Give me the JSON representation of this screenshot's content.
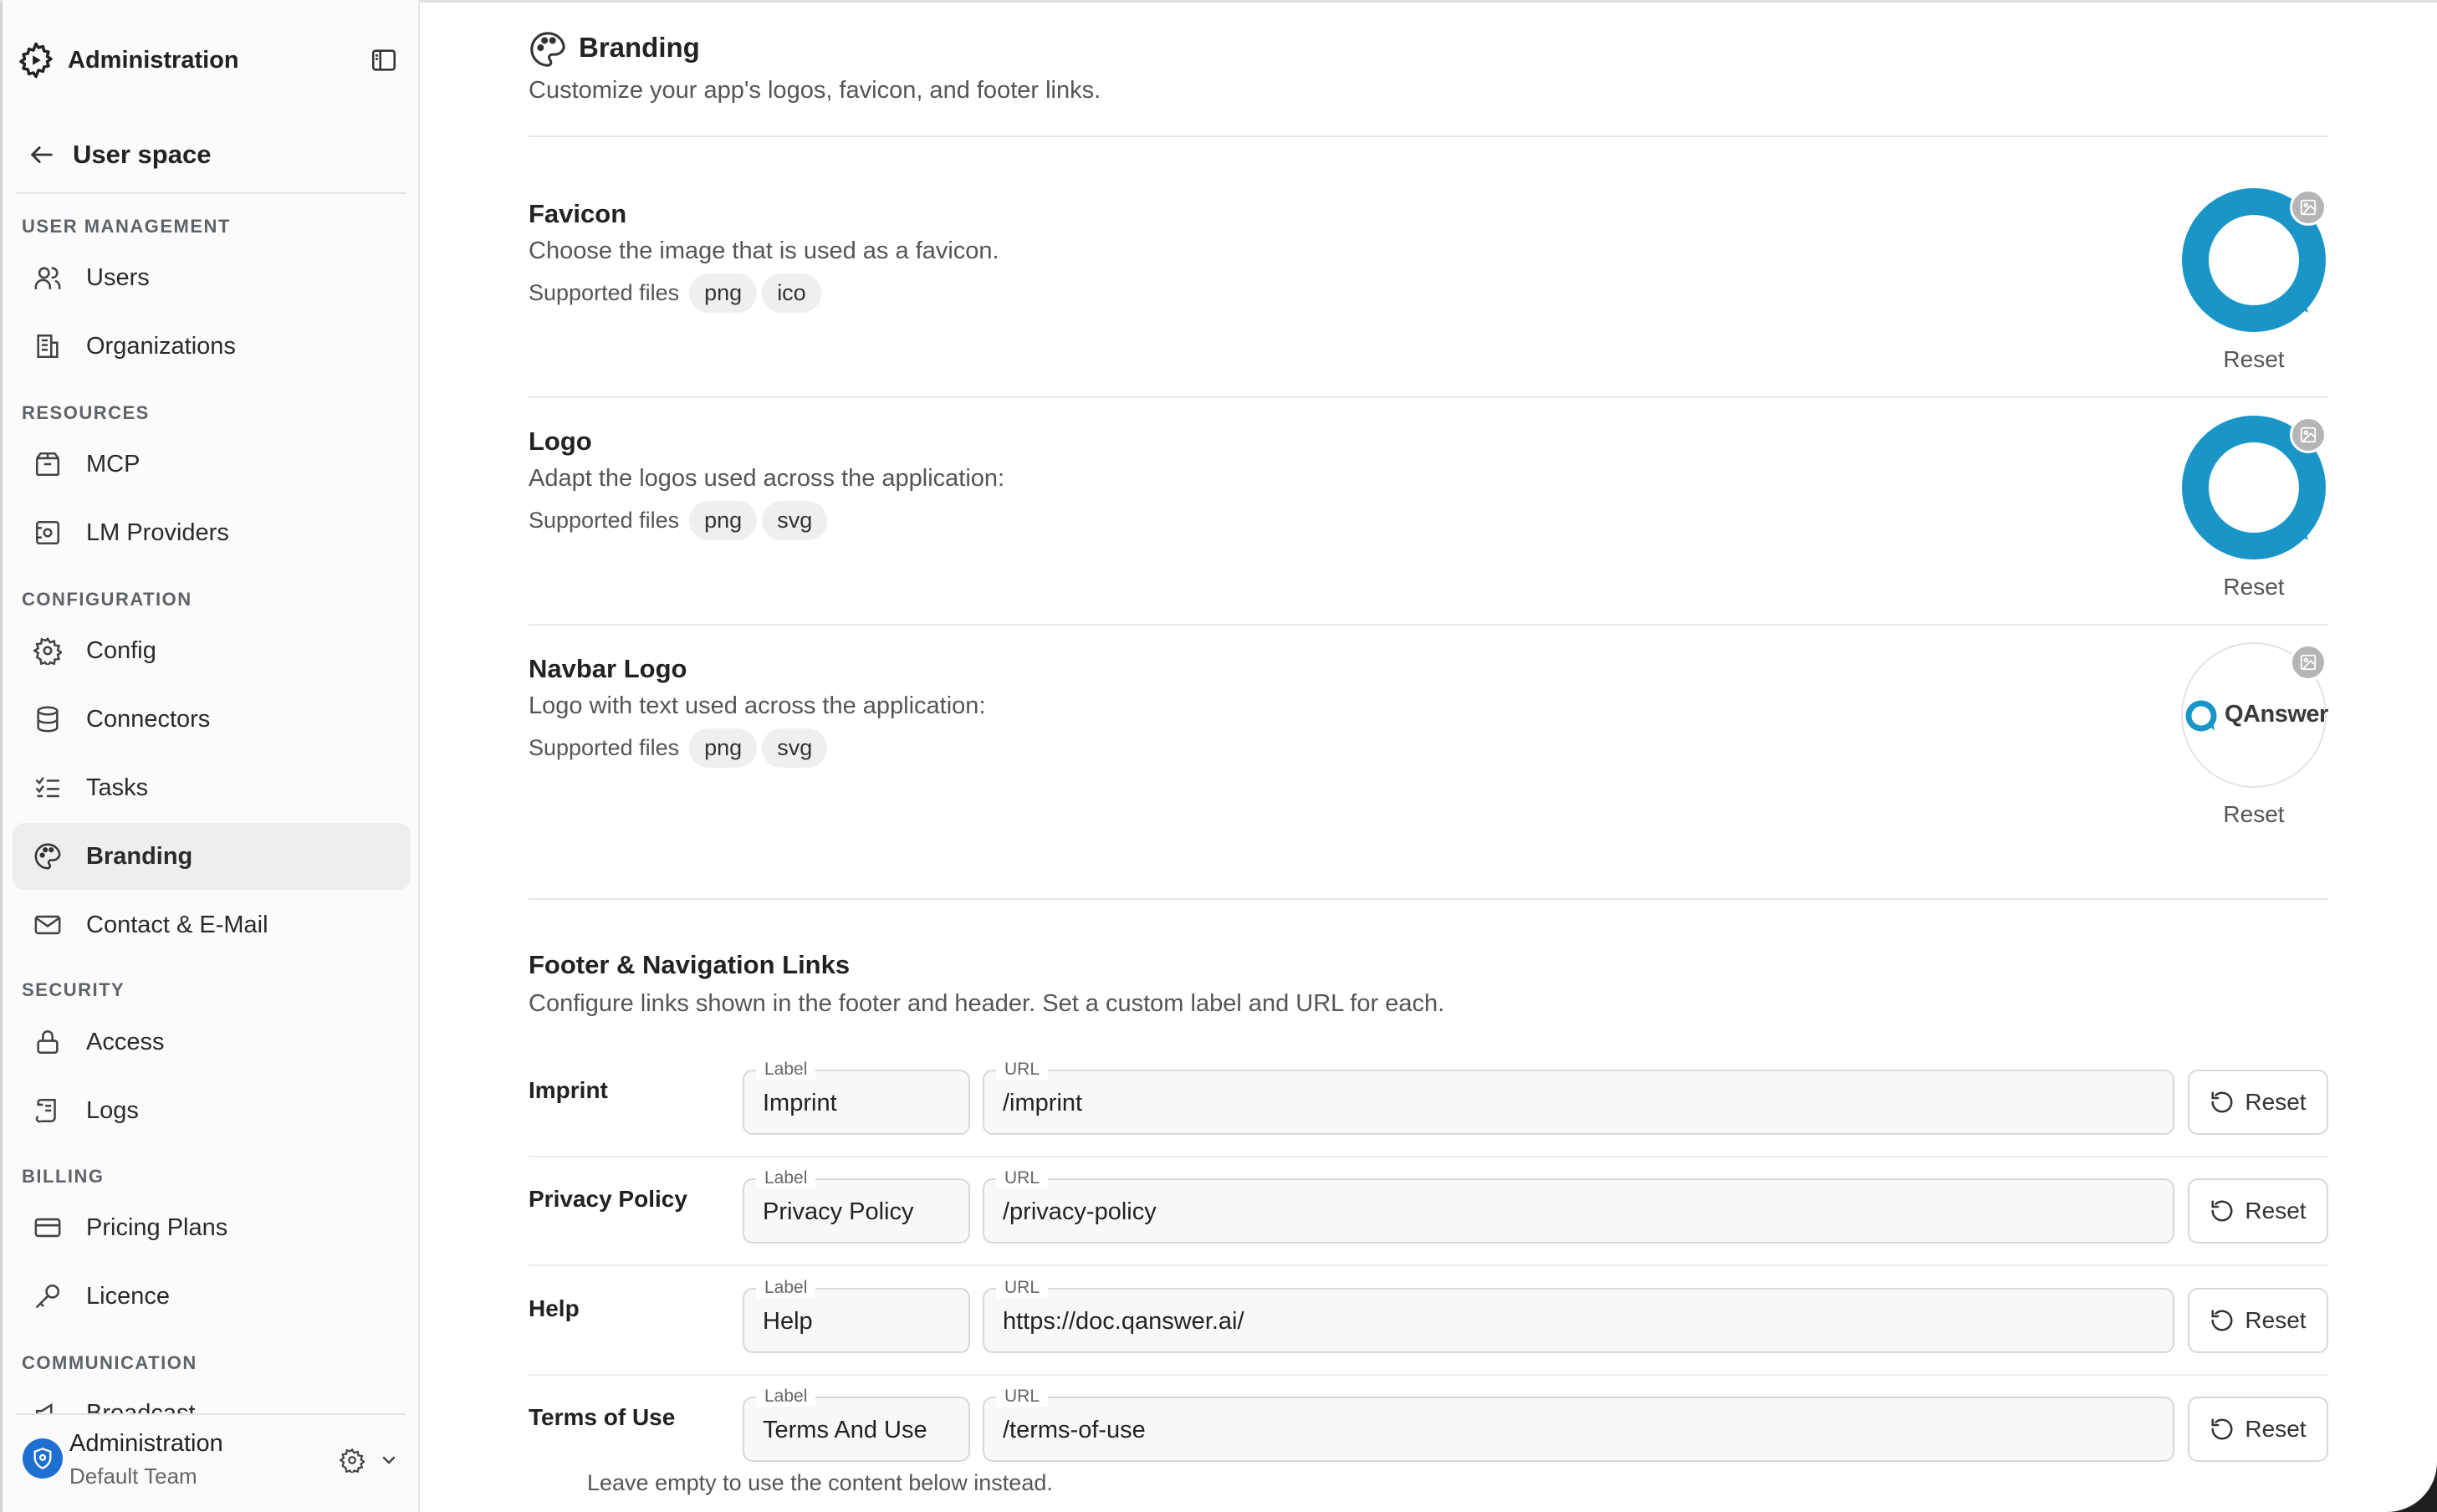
{
  "sidebar": {
    "title": "Administration",
    "back_label": "User space",
    "sections": {
      "user_management": "USER MANAGEMENT",
      "resources": "RESOURCES",
      "configuration": "CONFIGURATION",
      "security": "SECURITY",
      "billing": "BILLING",
      "communication": "COMMUNICATION"
    },
    "items": {
      "users": "Users",
      "organizations": "Organizations",
      "mcp": "MCP",
      "lm_providers": "LM Providers",
      "config": "Config",
      "connectors": "Connectors",
      "tasks": "Tasks",
      "branding": "Branding",
      "contact": "Contact & E-Mail",
      "access": "Access",
      "logs": "Logs",
      "pricing_plans": "Pricing Plans",
      "licence": "Licence",
      "broadcast": "Broadcast"
    },
    "active_item": "branding",
    "footer": {
      "name": "Administration",
      "team": "Default Team"
    }
  },
  "header": {
    "title": "Branding",
    "description": "Customize your app's logos, favicon, and footer links."
  },
  "assets": {
    "supported_label": "Supported files",
    "reset_label": "Reset",
    "favicon": {
      "title": "Favicon",
      "description": "Choose the image that is used as a favicon.",
      "types": [
        "png",
        "ico"
      ]
    },
    "logo": {
      "title": "Logo",
      "description": "Adapt the logos used across the application:",
      "types": [
        "png",
        "svg"
      ]
    },
    "navbar_logo": {
      "title": "Navbar Logo",
      "description": "Logo with text used across the application:",
      "types": [
        "png",
        "svg"
      ],
      "logo_text": "QAnswer"
    }
  },
  "footer_links": {
    "title": "Footer & Navigation Links",
    "description": "Configure links shown in the footer and header. Set a custom label and URL for each.",
    "label_caption": "Label",
    "url_caption": "URL",
    "reset_label": "Reset",
    "rows": [
      {
        "name": "Imprint",
        "label": "Imprint",
        "url": "/imprint"
      },
      {
        "name": "Privacy Policy",
        "label": "Privacy Policy",
        "url": "/privacy-policy"
      },
      {
        "name": "Help",
        "label": "Help",
        "url": "https://doc.qanswer.ai/"
      },
      {
        "name": "Terms of Use",
        "label": "Terms And Use",
        "url": "/terms-of-use"
      }
    ],
    "hint": "Leave empty to use the content below instead."
  },
  "colors": {
    "brand_blue": "#1a95c8",
    "avatar_blue": "#1f6fd1",
    "active_bg": "#eeeef0"
  }
}
